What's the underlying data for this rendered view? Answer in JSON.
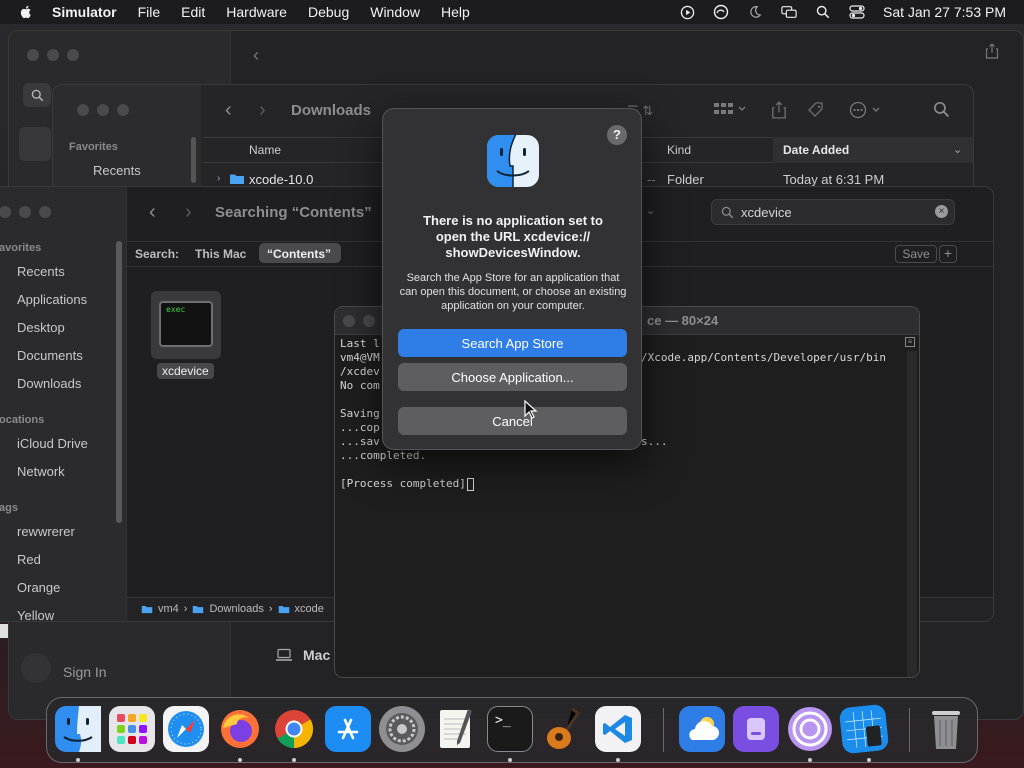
{
  "menubar": {
    "app_name": "Simulator",
    "items": [
      "File",
      "Edit",
      "Hardware",
      "Debug",
      "Window",
      "Help"
    ],
    "clock": "Sat Jan 27  7:53 PM"
  },
  "back_window": {
    "bottom_item": "Mac",
    "sign_in": "Sign In"
  },
  "downloads_window": {
    "title": "Downloads",
    "sidebar_heading": "Favorites",
    "sidebar_item": "Recents",
    "columns": {
      "name": "Name",
      "kind": "Kind",
      "date_added": "Date Added"
    },
    "row": {
      "name": "xcode-10.0",
      "kind": "Folder",
      "date": "Today at 6:31 PM"
    }
  },
  "search_window": {
    "title": "Searching “Contents”",
    "search_field_value": "xcdevice",
    "scope_label": "Search:",
    "scope_this_mac": "This Mac",
    "scope_contents": "“Contents”",
    "save_label": "Save",
    "add_label": "+",
    "sidebar": {
      "favorites_heading": "avorites",
      "favorites": [
        "Recents",
        "Applications",
        "Desktop",
        "Documents",
        "Downloads"
      ],
      "locations_heading": "ocations",
      "locations": [
        "iCloud Drive",
        "Network"
      ],
      "tags_heading": "ags",
      "tags": [
        "rewwrerer",
        "Red",
        "Orange",
        "Yellow"
      ]
    },
    "result_file": {
      "badge": "exec",
      "name": "xcdevice"
    },
    "path_bar": [
      "vm4",
      "Downloads",
      "xcode"
    ]
  },
  "terminal": {
    "title_fragment": "ce — 80×24",
    "lines": [
      "Last l",
      "vm4@VM",
      "/xcdev",
      "No com",
      "",
      "Saving",
      "...cop",
      "...sav",
      "...completed.",
      "",
      "[Process completed]"
    ],
    "right_fragments": {
      "line1": "/Xcode.app/Contents/Developer/usr/bin",
      "line7": "s..."
    }
  },
  "dialog": {
    "help": "?",
    "title": "There is no application set to\nopen the URL xcdevice://\nshowDevicesWindow.",
    "message": "Search the App Store for an application that can open this document, or choose an existing application on your computer.",
    "buttons": {
      "search_app_store": "Search App Store",
      "choose_application": "Choose Application...",
      "cancel": "Cancel"
    }
  },
  "colors": {
    "accent": "#2f7ee7",
    "folder_blue": "#4aa3f0"
  },
  "dock": {
    "apps": [
      "finder-icon",
      "launchpad-icon",
      "safari-icon",
      "firefox-icon",
      "chrome-icon",
      "app-store-icon",
      "system-settings-icon",
      "textedit-icon",
      "terminal-icon",
      "garageband-icon",
      "vscode-icon",
      "icloud-weather-icon",
      "purple-disk-icon",
      "torrent-icon",
      "xcode-icon",
      "trash-icon"
    ]
  }
}
